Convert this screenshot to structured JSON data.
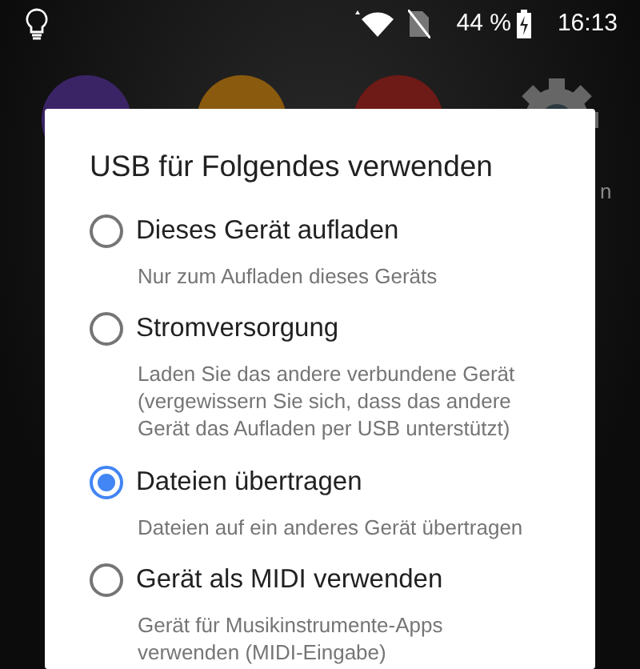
{
  "status_bar": {
    "battery": "44 %",
    "time": "16:13"
  },
  "home_screen": {
    "label_fragment": "n"
  },
  "dialog": {
    "title": "USB für Folgendes verwenden",
    "options": [
      {
        "label": "Dieses Gerät aufladen",
        "description": "Nur zum Aufladen dieses Geräts",
        "selected": false
      },
      {
        "label": "Stromversorgung",
        "description": "Laden Sie das andere verbundene Gerät (vergewissern Sie sich, dass das andere Gerät das Aufladen per USB unterstützt)",
        "selected": false
      },
      {
        "label": "Dateien übertragen",
        "description": "Dateien auf ein anderes Gerät übertragen",
        "selected": true
      },
      {
        "label": "Gerät als MIDI verwenden",
        "description": "Gerät für Musikinstrumente-Apps verwenden (MIDI-Eingabe)",
        "selected": false
      }
    ]
  }
}
